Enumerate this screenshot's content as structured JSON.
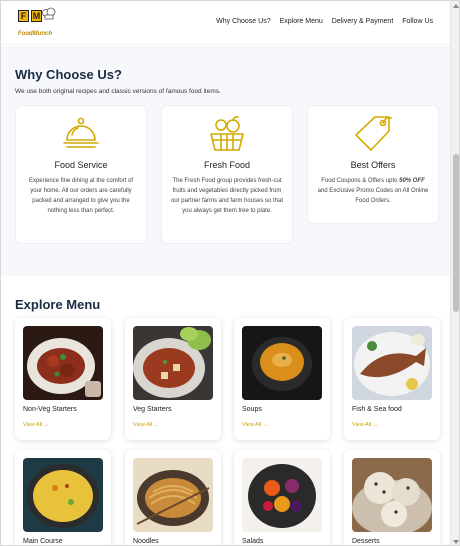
{
  "brand": {
    "initials_1": "F",
    "initials_2": "M",
    "name": "FoodMunch"
  },
  "nav": [
    "Why Choose Us?",
    "Explore Menu",
    "Delivery & Payment",
    "Follow Us"
  ],
  "why": {
    "title": "Why Choose Us?",
    "subtitle": "We use both original recipes and classic versions of famous food items.",
    "cards": [
      {
        "icon": "cloche-icon",
        "title": "Food Service",
        "text": "Experience fine dining at the comfort of your home. All our orders are carefully packed and arranged to give you the nothing less than perfect."
      },
      {
        "icon": "basket-icon",
        "title": "Fresh Food",
        "text": "The Fresh Food group provides fresh-cut fruits and vegetables directly picked from our partner farms and farm houses so that you always get them tree to plate."
      },
      {
        "icon": "price-tag-icon",
        "title": "Best Offers",
        "text_a": "Food Coupons & Offers upto ",
        "text_b": "50% OFF",
        "text_c": " and Exclusive Promo Codes on All Online Food Orders."
      }
    ]
  },
  "explore": {
    "title": "Explore Menu",
    "view_all": "View All →",
    "items": [
      {
        "name": "Non-Veg Starters"
      },
      {
        "name": "Veg Starters"
      },
      {
        "name": "Soups"
      },
      {
        "name": "Fish & Sea food"
      },
      {
        "name": "Main Course"
      },
      {
        "name": "Noodles"
      },
      {
        "name": "Salads"
      },
      {
        "name": "Desserts"
      }
    ]
  },
  "colors": {
    "accent": "#d4a900",
    "heading": "#1a2b45",
    "section_bg": "#f7f8fc"
  }
}
